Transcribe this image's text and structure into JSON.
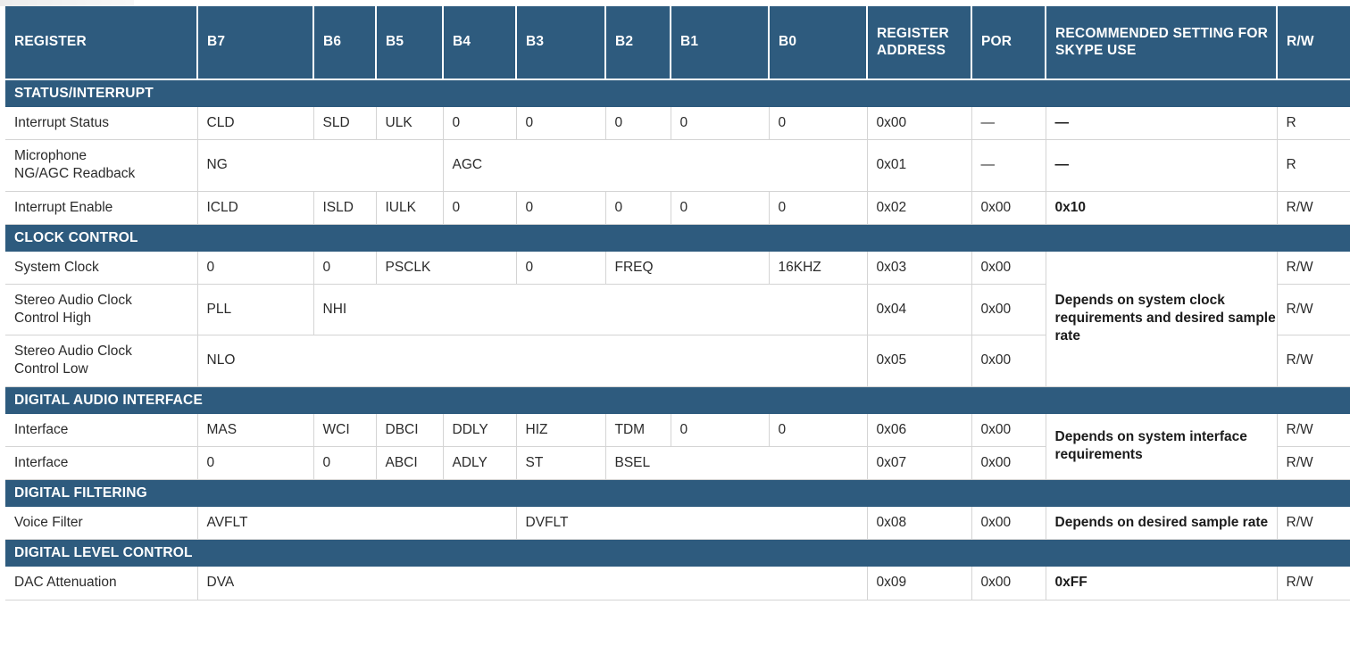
{
  "table": {
    "columns": [
      {
        "key": "register",
        "label": "REGISTER"
      },
      {
        "key": "b7",
        "label": "B7"
      },
      {
        "key": "b6",
        "label": "B6"
      },
      {
        "key": "b5",
        "label": "B5"
      },
      {
        "key": "b4",
        "label": "B4"
      },
      {
        "key": "b3",
        "label": "B3"
      },
      {
        "key": "b2",
        "label": "B2"
      },
      {
        "key": "b1",
        "label": "B1"
      },
      {
        "key": "b0",
        "label": "B0"
      },
      {
        "key": "address",
        "label": "REGISTER ADDRESS"
      },
      {
        "key": "por",
        "label": "POR"
      },
      {
        "key": "recommended",
        "label": "RECOMMENDED SETTING FOR SKYPE USE"
      },
      {
        "key": "rw",
        "label": "R/W"
      }
    ],
    "sections": [
      {
        "title": "STATUS/INTERRUPT",
        "rows": [
          {
            "register": "Interrupt Status",
            "bits": [
              "CLD",
              "SLD",
              "ULK",
              "0",
              "0",
              "0",
              "0",
              "0"
            ],
            "address": "0x00",
            "por": "—",
            "recommended": "—",
            "rw": "R"
          },
          {
            "register": "Microphone\nNG/AGC Readback",
            "bits": [
              "NG",
              "AGC"
            ],
            "address": "0x01",
            "por": "—",
            "recommended": "—",
            "rw": "R"
          },
          {
            "register": "Interrupt Enable",
            "bits": [
              "ICLD",
              "ISLD",
              "IULK",
              "0",
              "0",
              "0",
              "0",
              "0"
            ],
            "address": "0x02",
            "por": "0x00",
            "recommended": "0x10",
            "rw": "R/W"
          }
        ]
      },
      {
        "title": "CLOCK CONTROL",
        "rows": [
          {
            "register": "System Clock",
            "bits": [
              "0",
              "0",
              "PSCLK",
              "0",
              "FREQ",
              "16KHZ"
            ],
            "address": "0x03",
            "por": "0x00",
            "recommended": "Depends on system clock requirements and desired sample rate",
            "rw": "R/W"
          },
          {
            "register": "Stereo Audio Clock\nControl High",
            "bits": [
              "PLL",
              "NHI"
            ],
            "address": "0x04",
            "por": "0x00",
            "recommended": "",
            "rw": "R/W"
          },
          {
            "register": "Stereo Audio Clock\nControl Low",
            "bits": [
              "NLO"
            ],
            "address": "0x05",
            "por": "0x00",
            "recommended": "",
            "rw": "R/W"
          }
        ]
      },
      {
        "title": "DIGITAL AUDIO INTERFACE",
        "rows": [
          {
            "register": "Interface",
            "bits": [
              "MAS",
              "WCI",
              "DBCI",
              "DDLY",
              "HIZ",
              "TDM",
              "0",
              "0"
            ],
            "address": "0x06",
            "por": "0x00",
            "recommended": "Depends on system interface requirements",
            "rw": "R/W"
          },
          {
            "register": "Interface",
            "bits": [
              "0",
              "0",
              "ABCI",
              "ADLY",
              "ST",
              "BSEL"
            ],
            "address": "0x07",
            "por": "0x00",
            "recommended": "",
            "rw": "R/W"
          }
        ]
      },
      {
        "title": "DIGITAL FILTERING",
        "rows": [
          {
            "register": "Voice Filter",
            "bits": [
              "AVFLT",
              "DVFLT"
            ],
            "address": "0x08",
            "por": "0x00",
            "recommended": "Depends on desired sample rate",
            "rw": "R/W"
          }
        ]
      },
      {
        "title": "DIGITAL LEVEL CONTROL",
        "rows": [
          {
            "register": "DAC Attenuation",
            "bits": [
              "DVA"
            ],
            "address": "0x09",
            "por": "0x00",
            "recommended": "0xFF",
            "rw": "R/W"
          }
        ]
      }
    ]
  },
  "colors": {
    "header_blue": "#2e5b7e",
    "grid_line": "#d4d4d4",
    "text": "#2b2b2b",
    "header_text": "#ffffff"
  }
}
